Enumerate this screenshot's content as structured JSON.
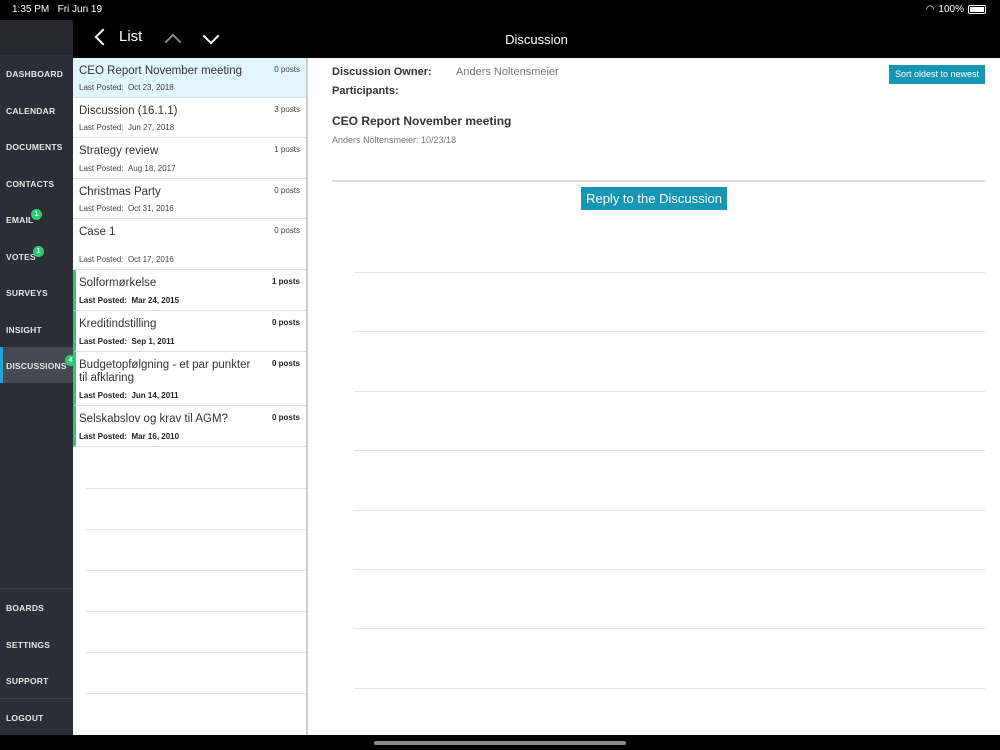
{
  "status": {
    "time": "1:35 PM",
    "date": "Fri Jun 19",
    "battery": "100%"
  },
  "header": {
    "back_label": "List",
    "title": "Discussion"
  },
  "sidebar": {
    "items": [
      {
        "label": "DASHBOARD"
      },
      {
        "label": "CALENDAR"
      },
      {
        "label": "DOCUMENTS"
      },
      {
        "label": "CONTACTS"
      },
      {
        "label": "EMAIL",
        "badge": "1"
      },
      {
        "label": "VOTES",
        "badge": "1"
      },
      {
        "label": "SURVEYS"
      },
      {
        "label": "INSIGHT"
      },
      {
        "label": "DISCUSSIONS",
        "badge": "4"
      }
    ],
    "bottom_items": [
      {
        "label": "BOARDS"
      },
      {
        "label": "SETTINGS"
      },
      {
        "label": "SUPPORT"
      },
      {
        "label": "LOGOUT"
      }
    ]
  },
  "list": {
    "last_posted_label": "Last Posted:",
    "items": [
      {
        "title": "CEO Report November meeting",
        "posts": "0 posts",
        "date": "Oct 23, 2018"
      },
      {
        "title": "Discussion (16.1.1)",
        "posts": "3 posts",
        "date": "Jun 27, 2018"
      },
      {
        "title": "Strategy review",
        "posts": "1 posts",
        "date": "Aug 18, 2017"
      },
      {
        "title": "Christmas Party",
        "posts": "0 posts",
        "date": "Oct 31, 2016"
      },
      {
        "title": "Case 1",
        "posts": "0 posts",
        "date": "Oct 17, 2016"
      },
      {
        "title": "Solformørkelse",
        "posts": "1 posts",
        "date": "Mar 24, 2015"
      },
      {
        "title": "Kreditindstilling",
        "posts": "0 posts",
        "date": "Sep 1, 2011"
      },
      {
        "title": "Budgetopfølgning - et par punkter til afklaring",
        "posts": "0 posts",
        "date": "Jun 14, 2011"
      },
      {
        "title": "Selskabslov og krav til AGM?",
        "posts": "0 posts",
        "date": "Mar 16, 2010"
      }
    ]
  },
  "detail": {
    "owner_label": "Discussion Owner:",
    "owner": "Anders Noltensmeier",
    "participants_label": "Participants:",
    "sort_button": "Sort oldest to newest",
    "title": "CEO Report November meeting",
    "meta": "Anders Noltensmeier: 10/23/18",
    "reply_button": "Reply to the Discussion"
  },
  "colors": {
    "accent": "#1696b4",
    "unread": "#2ecc71",
    "selected": "#e1f5fd"
  }
}
